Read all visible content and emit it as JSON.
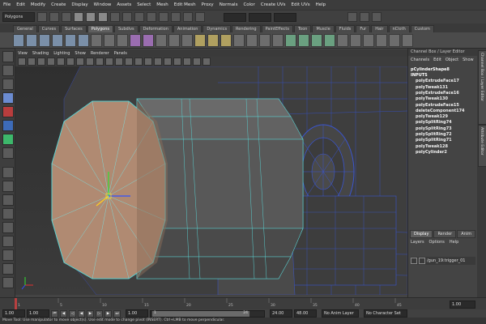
{
  "menubar": {
    "items": [
      "File",
      "Edit",
      "Modify",
      "Create",
      "Display",
      "Window",
      "Assets",
      "Select",
      "Mesh",
      "Edit Mesh",
      "Proxy",
      "Normals",
      "Color",
      "Create UVs",
      "Edit UVs",
      "Help"
    ]
  },
  "statusline": {
    "mode": "Polygons"
  },
  "shelf": {
    "tabs": [
      "General",
      "Curves",
      "Surfaces",
      "Polygons",
      "Subdivs",
      "Deformation",
      "Animation",
      "Dynamics",
      "Rendering",
      "PaintEffects",
      "Toon",
      "Muscle",
      "Fluids",
      "Fur",
      "Hair",
      "nCloth",
      "Custom"
    ],
    "active": "Polygons"
  },
  "panel": {
    "menus": [
      "View",
      "Shading",
      "Lighting",
      "Show",
      "Renderer",
      "Panels"
    ]
  },
  "channelbox": {
    "title": "Channel Box / Layer Editor",
    "menus": [
      "Channels",
      "Edit",
      "Object",
      "Show"
    ],
    "shape": "pCylinderShape8",
    "inputs_header": "INPUTS",
    "inputs": [
      "polyExtrudeFace17",
      "polyTweak131",
      "polyExtrudeFace16",
      "polyTweak130",
      "polyExtrudeFace15",
      "deleteComponent174",
      "polyTweak129",
      "polySplitRing74",
      "polySplitRing73",
      "polySplitRing72",
      "polySplitRing71",
      "polyTweak128",
      "polyCylinder2"
    ]
  },
  "layers": {
    "tabs": [
      "Display",
      "Render",
      "Anim"
    ],
    "active": "Display",
    "menus": [
      "Layers",
      "Options",
      "Help"
    ],
    "layer_name": "/gun_19:trigger_01"
  },
  "sidetabs": {
    "labels": [
      "Channel Box / Layer Editor",
      "Attribute Editor"
    ]
  },
  "timeline": {
    "ticks": [
      "1",
      "5",
      "10",
      "15",
      "20",
      "25",
      "30",
      "35",
      "40",
      "45"
    ]
  },
  "range": {
    "start": "1.00",
    "current_start": "1.00",
    "slider_start": "1",
    "slider_end": "24",
    "end": "24.00",
    "max_end": "48.00",
    "anim_layer": "No Anim Layer",
    "char_set": "No Character Set",
    "current_frame": "1.00",
    "frame_field": "1.00"
  },
  "helpline": {
    "text": "Move Tool: Use manipulator to move object(s). Use edit mode to change pivot (INSERT).  Ctrl+LMB to move perpendicular."
  },
  "colors": {
    "accent": "#6b8bd0",
    "mesh_wire": "#5ad0d0",
    "cap_face": "#b08a72",
    "body_face": "#5a5a5a"
  }
}
